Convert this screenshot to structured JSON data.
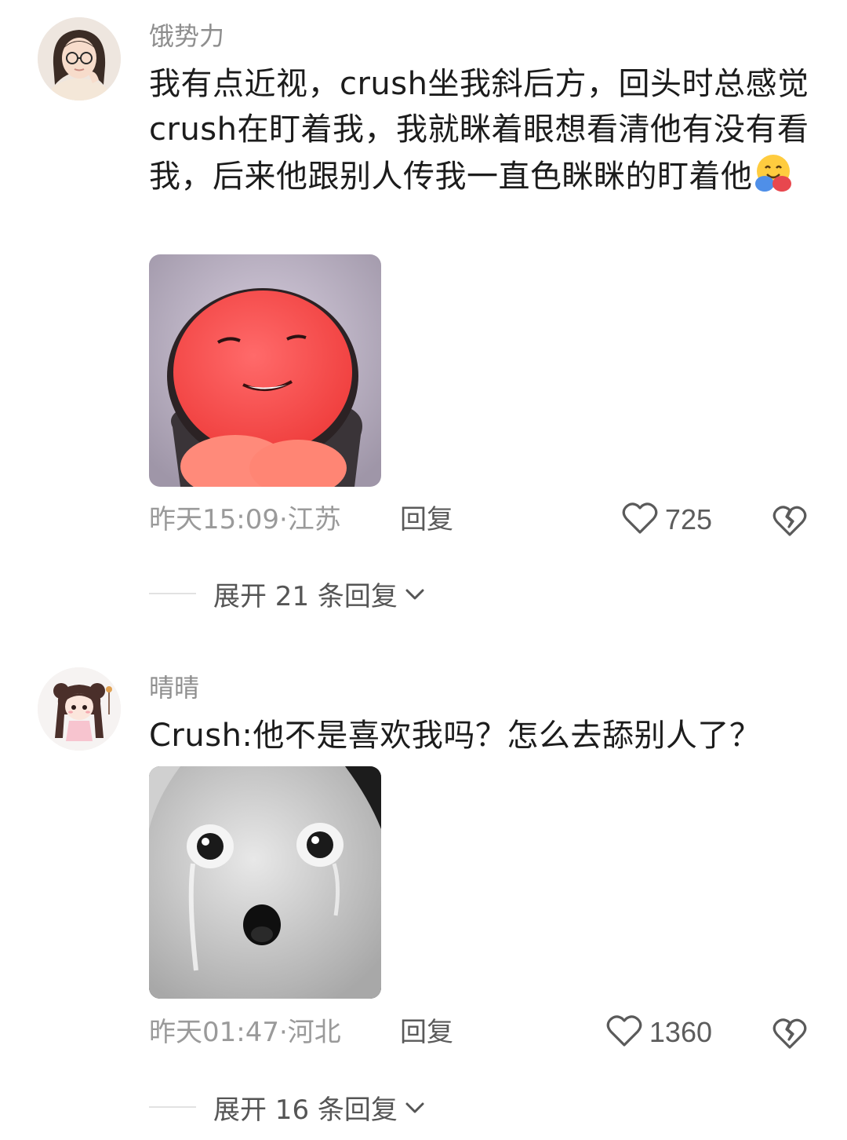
{
  "comments": [
    {
      "username": "饿势力",
      "text": "我有点近视，crush坐我斜后方，回头时总感觉crush在盯着我，我就眯着眼想看清他有没有看我，后来他跟别人传我一直色眯眯的盯着他",
      "emoji": "hugging-face-emoji",
      "time_location": "昨天15:09·江苏",
      "reply_label": "回复",
      "likes": "725",
      "expand_label": "展开 21 条回复",
      "sticker": "red-round-face-smirk-sticker"
    },
    {
      "username": "晴晴",
      "text": "Crush:他不是喜欢我吗？怎么去舔别人了？",
      "time_location": "昨天01:47·河北",
      "reply_label": "回复",
      "likes": "1360",
      "expand_label": "展开 16 条回复",
      "sticker": "crying-white-doll-sticker"
    }
  ],
  "icons": {
    "like": "heart-outline-icon",
    "dislike": "broken-heart-icon",
    "expand": "chevron-down-icon"
  },
  "colors": {
    "username": "#8e8e8e",
    "meta": "#9a9a9a",
    "text": "#1c1c1c"
  }
}
